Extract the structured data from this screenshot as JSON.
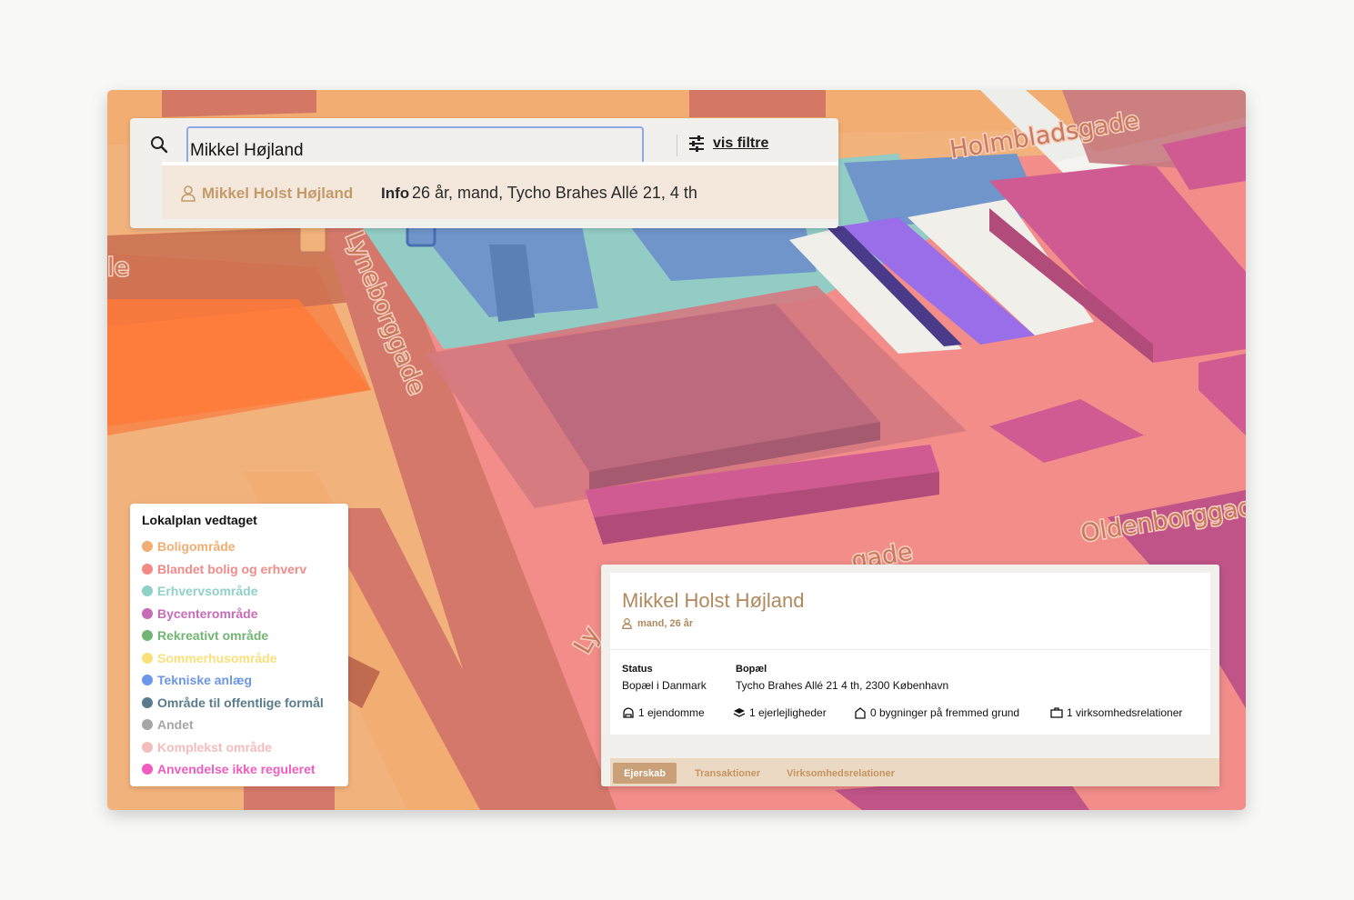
{
  "search": {
    "query": "Mikkel Højland",
    "filter_label": "vis filtre",
    "result": {
      "name": "Mikkel Holst Højland",
      "info_label": "Info",
      "info_text": "26 år, mand, Tycho Brahes Allé 21, 4 th"
    }
  },
  "map": {
    "street_labels": [
      "Holmbladsgade",
      "Lyneborggade",
      "Oldenborggad",
      "gade",
      "le",
      "Ly"
    ]
  },
  "legend": {
    "title": "Lokalplan vedtaget",
    "items": [
      {
        "label": "Boligområde",
        "color": "#f2ad72"
      },
      {
        "label": "Blandet bolig og erhverv",
        "color": "#f28b87"
      },
      {
        "label": "Erhvervsområde",
        "color": "#8fd1c8"
      },
      {
        "label": "Bycenterområde",
        "color": "#c76bb8"
      },
      {
        "label": "Rekreativt område",
        "color": "#72b573"
      },
      {
        "label": "Sommerhusområde",
        "color": "#fbe07a"
      },
      {
        "label": "Tekniske anlæg",
        "color": "#6c97e8"
      },
      {
        "label": "Område til offentlige formål",
        "color": "#5a7b8c"
      },
      {
        "label": "Andet",
        "color": "#a6a6a6"
      },
      {
        "label": "Komplekst område",
        "color": "#f5bcbc"
      },
      {
        "label": "Anvendelse ikke reguleret",
        "color": "#f05cbf"
      }
    ]
  },
  "card": {
    "name": "Mikkel Holst Højland",
    "subtitle": "mand, 26 år",
    "status_label": "Status",
    "status_value": "Bopæl i Danmark",
    "bopael_label": "Bopæl",
    "bopael_value": "Tycho Brahes Allé 21 4 th, 2300 København",
    "stats": [
      "1 ejendomme",
      "1 ejerlejligheder",
      "0 bygninger på fremmed grund",
      "1 virksomhedsrelationer"
    ],
    "tabs": [
      "Ejerskab",
      "Transaktioner",
      "Virksomhedsrelationer"
    ]
  }
}
